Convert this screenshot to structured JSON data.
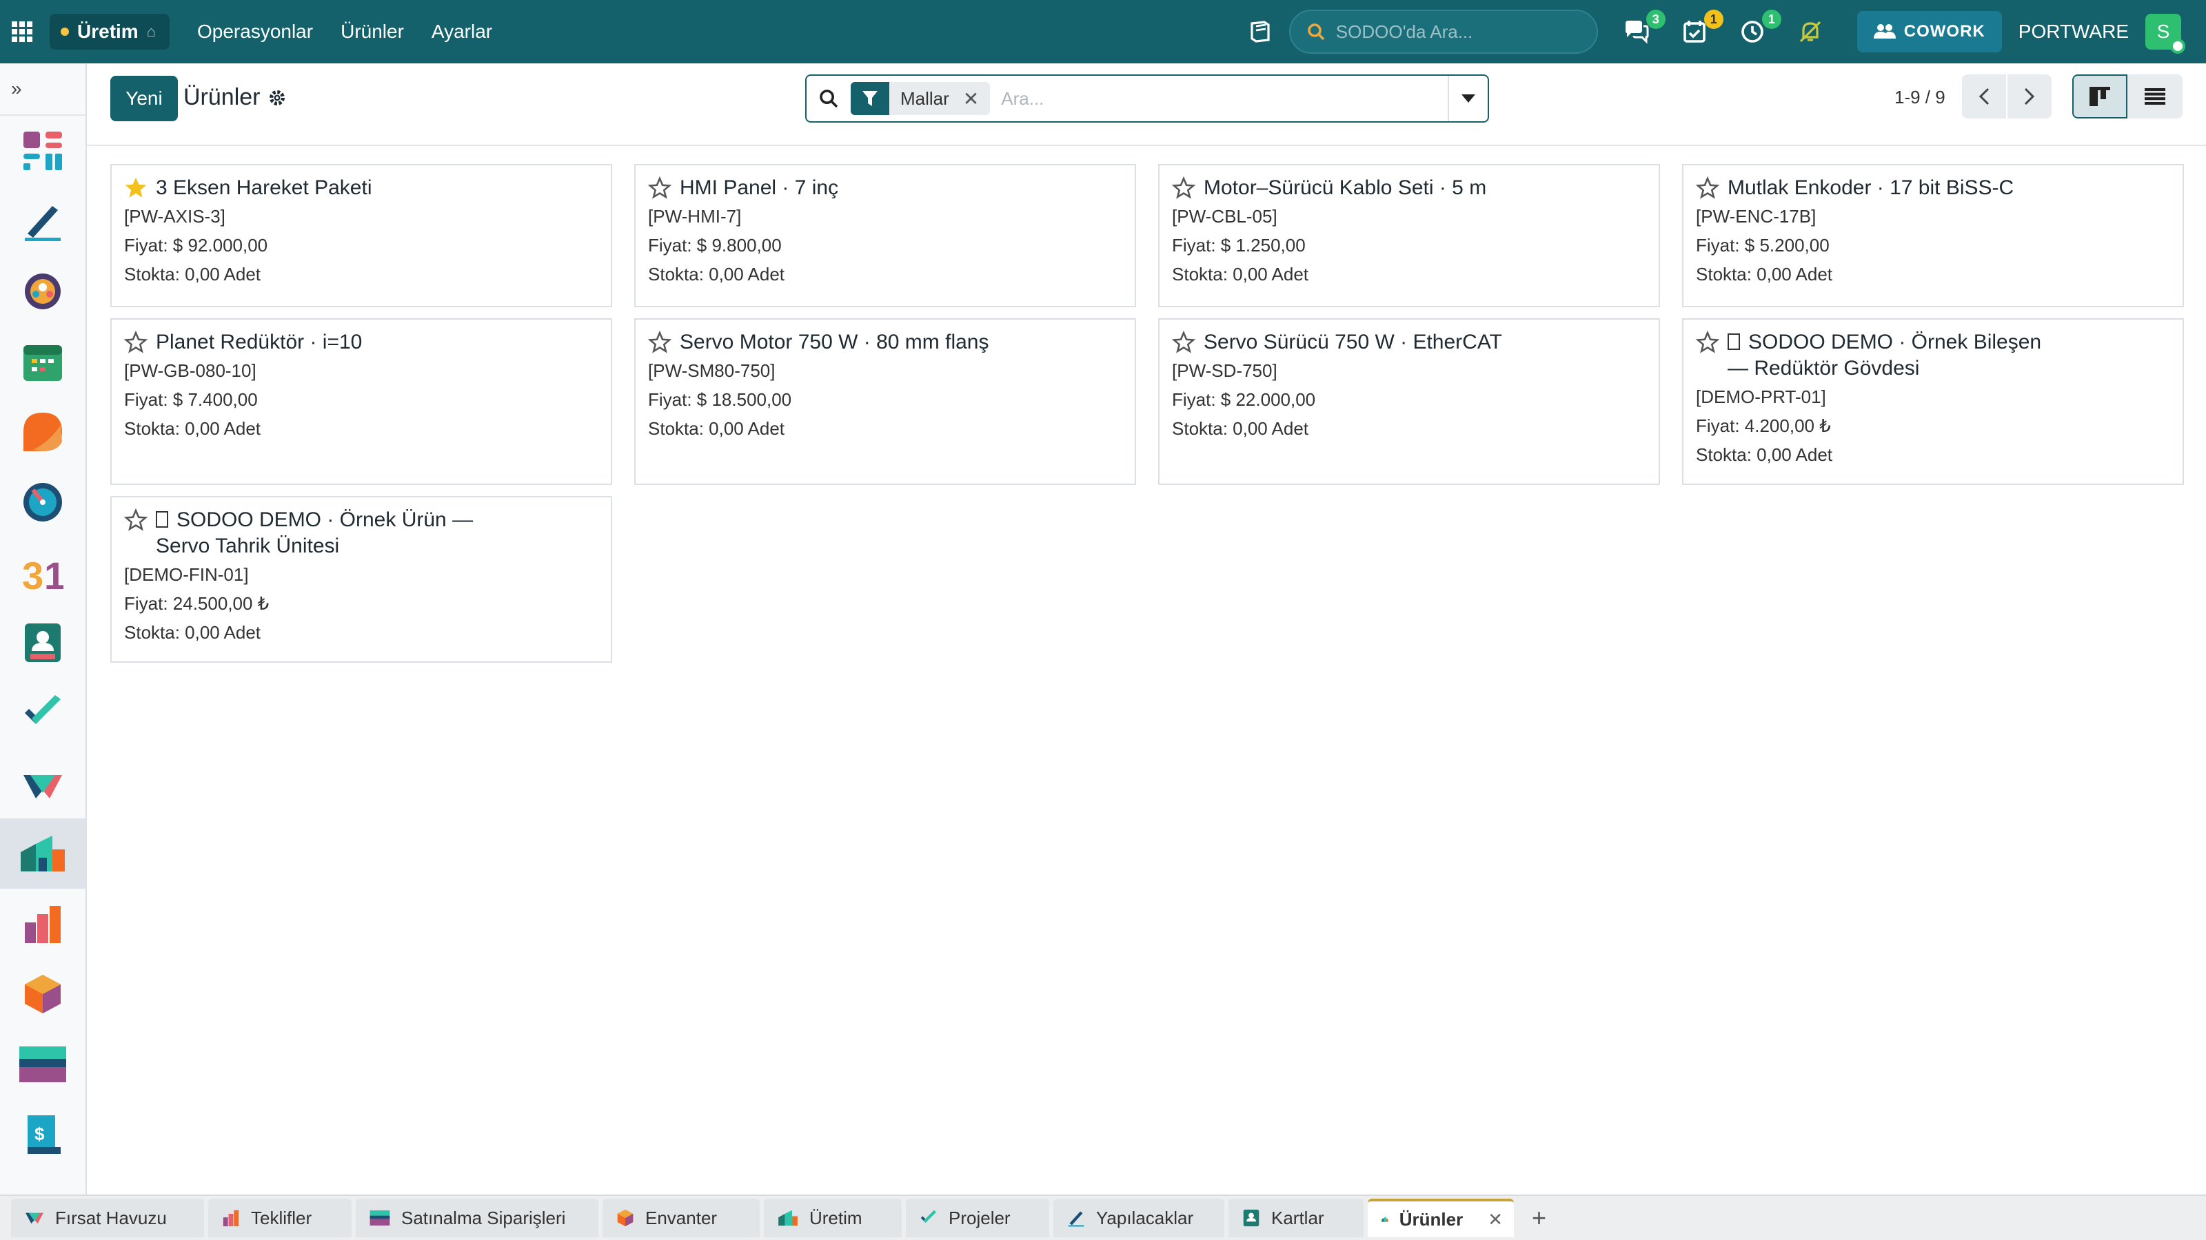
{
  "navbar": {
    "app_name": "Üretim",
    "menu": [
      "Operasyonlar",
      "Ürünler",
      "Ayarlar"
    ],
    "search_placeholder": "SODOO'da Ara...",
    "badges": {
      "messages": "3",
      "activities": "1",
      "timesheet": "1"
    },
    "cowork_label": "COWORK",
    "company": "PORTWARE",
    "avatar_letter": "S"
  },
  "control": {
    "new_label": "Yeni",
    "title": "Ürünler",
    "facet_label": "Mallar",
    "search_placeholder": "Ara...",
    "pager": "1-9 / 9"
  },
  "products": [
    {
      "name": "3 Eksen Hareket Paketi",
      "code": "[PW-AXIS-3]",
      "price": "Fiyat: $ 92.000,00",
      "stock": "Stokta: 0,00 Adet",
      "starred": true
    },
    {
      "name": "HMI Panel · 7 inç",
      "code": "[PW-HMI-7]",
      "price": "Fiyat: $ 9.800,00",
      "stock": "Stokta: 0,00 Adet",
      "starred": false
    },
    {
      "name": "Motor–Sürücü Kablo Seti · 5 m",
      "code": "[PW-CBL-05]",
      "price": "Fiyat: $ 1.250,00",
      "stock": "Stokta: 0,00 Adet",
      "starred": false
    },
    {
      "name": "Mutlak Enkoder · 17 bit BiSS-C",
      "code": "[PW-ENC-17B]",
      "price": "Fiyat: $ 5.200,00",
      "stock": "Stokta: 0,00 Adet",
      "starred": false
    },
    {
      "name": "Planet Redüktör · i=10",
      "code": "[PW-GB-080-10]",
      "price": "Fiyat: $ 7.400,00",
      "stock": "Stokta: 0,00 Adet",
      "starred": false
    },
    {
      "name": "Servo Motor 750 W · 80 mm flanş",
      "code": "[PW-SM80-750]",
      "price": "Fiyat: $ 18.500,00",
      "stock": "Stokta: 0,00 Adet",
      "starred": false
    },
    {
      "name": "Servo Sürücü 750 W · EtherCAT",
      "code": "[PW-SD-750]",
      "price": "Fiyat: $ 22.000,00",
      "stock": "Stokta: 0,00 Adet",
      "starred": false
    },
    {
      "name_line1": "SODOO DEMO · Örnek Bileşen",
      "name_line2": "— Redüktör Gövdesi",
      "code": "[DEMO-PRT-01]",
      "price": "Fiyat: 4.200,00 ₺",
      "stock": "Stokta: 0,00 Adet",
      "starred": false
    },
    {
      "name_line1": "SODOO DEMO · Örnek Ürün —",
      "name_line2": "Servo Tahrik Ünitesi",
      "code": "[DEMO-FIN-01]",
      "price": "Fiyat: 24.500,00 ₺",
      "stock": "Stokta: 0,00 Adet",
      "starred": false
    }
  ],
  "tabs": [
    {
      "label": "Fırsat Havuzu",
      "icon": "crm-icon"
    },
    {
      "label": "Teklifler",
      "icon": "sales-icon"
    },
    {
      "label": "Satınalma Siparişleri",
      "icon": "purchase-icon"
    },
    {
      "label": "Envanter",
      "icon": "inventory-icon"
    },
    {
      "label": "Üretim",
      "icon": "manufacturing-icon"
    },
    {
      "label": "Projeler",
      "icon": "project-icon"
    },
    {
      "label": "Yapılacaklar",
      "icon": "todo-icon"
    },
    {
      "label": "Kartlar",
      "icon": "contacts-icon"
    },
    {
      "label": "Ürünler",
      "icon": "manufacturing-icon",
      "active": true
    }
  ],
  "colors": {
    "brand": "#14616c",
    "star_active": "#f3c11b"
  }
}
